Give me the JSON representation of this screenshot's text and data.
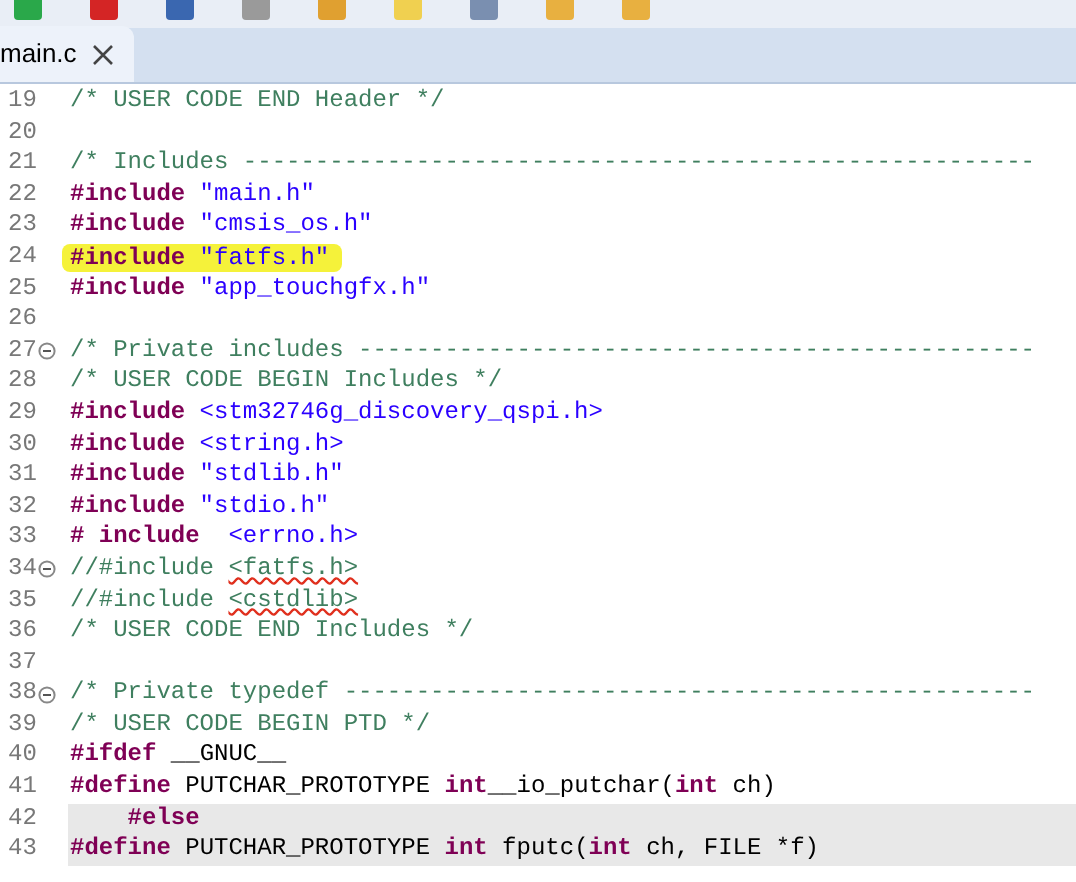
{
  "tabs": [
    {
      "label": "main.c",
      "selected": true
    }
  ],
  "lines": [
    {
      "number": "19",
      "fold": false,
      "marked": false,
      "current": false,
      "tokens": [
        {
          "kind": "comment",
          "text": "/* USER CODE END Header */"
        }
      ]
    },
    {
      "number": "20",
      "fold": false
    },
    {
      "number": "21",
      "fold": false,
      "marked": false,
      "current": false,
      "tokens": [
        {
          "kind": "comment",
          "text": "/* Includes -------------------------------------------------------"
        }
      ]
    },
    {
      "number": "22",
      "fold": false,
      "marked": false,
      "current": false,
      "tokens": [
        {
          "kind": "directive",
          "text": "#include"
        },
        {
          "kind": "string",
          "text": " \"main.h\""
        }
      ]
    },
    {
      "number": "23",
      "fold": false,
      "marked": false,
      "current": false,
      "tokens": [
        {
          "kind": "directive",
          "text": "#include"
        },
        {
          "kind": "string",
          "text": " \"cmsis_os.h\""
        }
      ]
    },
    {
      "number": "24",
      "fold": false,
      "marked": true,
      "current": false,
      "tokens": [
        {
          "kind": "directive",
          "text": "#include"
        },
        {
          "kind": "string",
          "text": " \"fatfs.h\""
        }
      ]
    },
    {
      "number": "25",
      "fold": false,
      "marked": false,
      "current": false,
      "tokens": [
        {
          "kind": "directive",
          "text": "#include"
        },
        {
          "kind": "string",
          "text": " \"app_touchgfx.h\""
        }
      ]
    },
    {
      "number": "26",
      "fold": false
    },
    {
      "number": "27",
      "fold": true,
      "marked": false,
      "current": false,
      "tokens": [
        {
          "kind": "comment",
          "text": "/* Private includes -----------------------------------------------"
        }
      ]
    },
    {
      "number": "28",
      "fold": false,
      "marked": false,
      "current": false,
      "tokens": [
        {
          "kind": "comment",
          "text": "/* USER CODE BEGIN Includes */"
        }
      ]
    },
    {
      "number": "29",
      "fold": false,
      "marked": false,
      "current": false,
      "tokens": [
        {
          "kind": "directive",
          "text": "#include"
        },
        {
          "kind": "string",
          "text": " <stm32746g_discovery_qspi.h>"
        }
      ]
    },
    {
      "number": "30",
      "fold": false,
      "marked": false,
      "current": false,
      "tokens": [
        {
          "kind": "directive",
          "text": "#include"
        },
        {
          "kind": "string",
          "text": " <string.h>"
        }
      ]
    },
    {
      "number": "31",
      "fold": false,
      "marked": false,
      "current": false,
      "tokens": [
        {
          "kind": "directive",
          "text": "#include"
        },
        {
          "kind": "string",
          "text": " \"stdlib.h\""
        }
      ]
    },
    {
      "number": "32",
      "fold": false,
      "marked": false,
      "current": false,
      "tokens": [
        {
          "kind": "directive",
          "text": "#include"
        },
        {
          "kind": "string",
          "text": " \"stdio.h\""
        }
      ]
    },
    {
      "number": "33",
      "fold": false,
      "marked": false,
      "current": false,
      "tokens": [
        {
          "kind": "directive",
          "text": "# include"
        },
        {
          "kind": "string",
          "text": "  <errno.h>"
        }
      ]
    },
    {
      "number": "34",
      "fold": true,
      "marked": false,
      "current": false,
      "tokens": [
        {
          "kind": "comment",
          "text": "//#include "
        },
        {
          "kind": "misspelled",
          "text": "<fatfs.h>"
        }
      ]
    },
    {
      "number": "35",
      "fold": false,
      "marked": false,
      "current": false,
      "tokens": [
        {
          "kind": "comment",
          "text": "//#include "
        },
        {
          "kind": "misspelled",
          "text": "<cstdlib>"
        }
      ]
    },
    {
      "number": "36",
      "fold": false,
      "marked": false,
      "current": false,
      "tokens": [
        {
          "kind": "comment",
          "text": "/* USER CODE END Includes */"
        }
      ]
    },
    {
      "number": "37",
      "fold": false
    },
    {
      "number": "38",
      "fold": true,
      "marked": false,
      "current": false,
      "tokens": [
        {
          "kind": "comment",
          "text": "/* Private typedef ------------------------------------------------"
        }
      ]
    },
    {
      "number": "39",
      "fold": false,
      "marked": false,
      "current": false,
      "tokens": [
        {
          "kind": "comment",
          "text": "/* USER CODE BEGIN PTD */"
        }
      ]
    },
    {
      "number": "40",
      "fold": false,
      "marked": false,
      "current": false,
      "tokens": [
        {
          "kind": "directive",
          "text": "#ifdef"
        },
        {
          "kind": "plain",
          "text": " __GNUC__"
        }
      ]
    },
    {
      "number": "41",
      "fold": false,
      "marked": false,
      "current": false,
      "tokens": [
        {
          "kind": "directive",
          "text": "#define"
        },
        {
          "kind": "plain",
          "text": " PUTCHAR_PROTOTYPE "
        },
        {
          "kind": "keyword",
          "text": "int"
        },
        {
          "kind": "plain",
          "text": "__io_putchar("
        },
        {
          "kind": "keyword",
          "text": "int"
        },
        {
          "kind": "plain",
          "text": " ch)"
        }
      ]
    },
    {
      "number": "42",
      "fold": false,
      "marked": false,
      "current": true,
      "tokens": [
        {
          "kind": "directive",
          "text": "    #else"
        }
      ]
    },
    {
      "number": "43",
      "fold": false,
      "marked": false,
      "current": true,
      "tokens": [
        {
          "kind": "directive",
          "text": "#define"
        },
        {
          "kind": "plain",
          "text": " PUTCHAR_PROTOTYPE "
        },
        {
          "kind": "keyword",
          "text": "int"
        },
        {
          "kind": "plain",
          "text": " fputc("
        },
        {
          "kind": "keyword",
          "text": "int"
        },
        {
          "kind": "plain",
          "text": " ch, FILE *f)"
        }
      ]
    }
  ]
}
